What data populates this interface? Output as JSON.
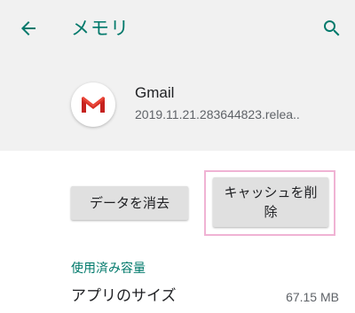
{
  "appbar": {
    "title": "メモリ",
    "back_icon": "arrow-back-icon",
    "search_icon": "search-icon"
  },
  "app": {
    "name": "Gmail",
    "version": "2019.11.21.283644823.relea..",
    "icon": "gmail-icon"
  },
  "actions": {
    "clear_data_label": "データを消去",
    "clear_cache_label": "キャッシュを削除"
  },
  "storage": {
    "section_title": "使用済み容量",
    "app_size_label": "アプリのサイズ",
    "app_size_value": "67.15 MB"
  },
  "colors": {
    "accent": "#00796b",
    "header_bg": "#f1f1f1",
    "highlight": "#f0b3d4"
  }
}
